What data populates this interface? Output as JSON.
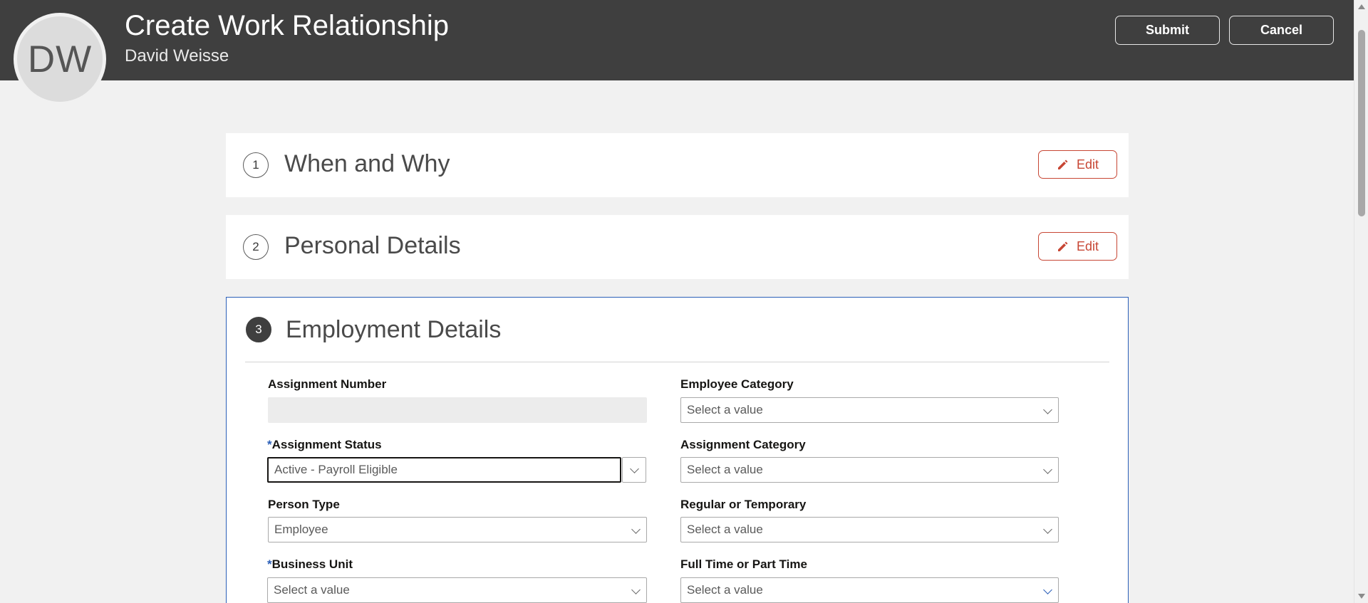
{
  "header": {
    "avatar_initials": "DW",
    "title": "Create Work Relationship",
    "subtitle": "David Weisse",
    "submit_label": "Submit",
    "cancel_label": "Cancel"
  },
  "steps": [
    {
      "number": "1",
      "title": "When and Why",
      "edit_label": "Edit"
    },
    {
      "number": "2",
      "title": "Personal Details",
      "edit_label": "Edit"
    },
    {
      "number": "3",
      "title": "Employment Details"
    }
  ],
  "form": {
    "left": [
      {
        "label": "Assignment Number",
        "required": false,
        "value": "",
        "placeholder": ""
      },
      {
        "label": "Assignment Status",
        "required": true,
        "value": "Active - Payroll Eligible"
      },
      {
        "label": "Person Type",
        "required": false,
        "value": "Employee"
      },
      {
        "label": "Business Unit",
        "required": true,
        "value": "Select a value"
      }
    ],
    "right": [
      {
        "label": "Employee Category",
        "value": "Select a value"
      },
      {
        "label": "Assignment Category",
        "value": "Select a value"
      },
      {
        "label": "Regular or Temporary",
        "value": "Select a value"
      },
      {
        "label": "Full Time or Part Time",
        "value": "Select a value"
      }
    ],
    "required_marker": "*"
  },
  "colors": {
    "header_bg": "#3f3f3f",
    "accent_blue": "#2b5fb8",
    "edit_red": "#c74634"
  }
}
